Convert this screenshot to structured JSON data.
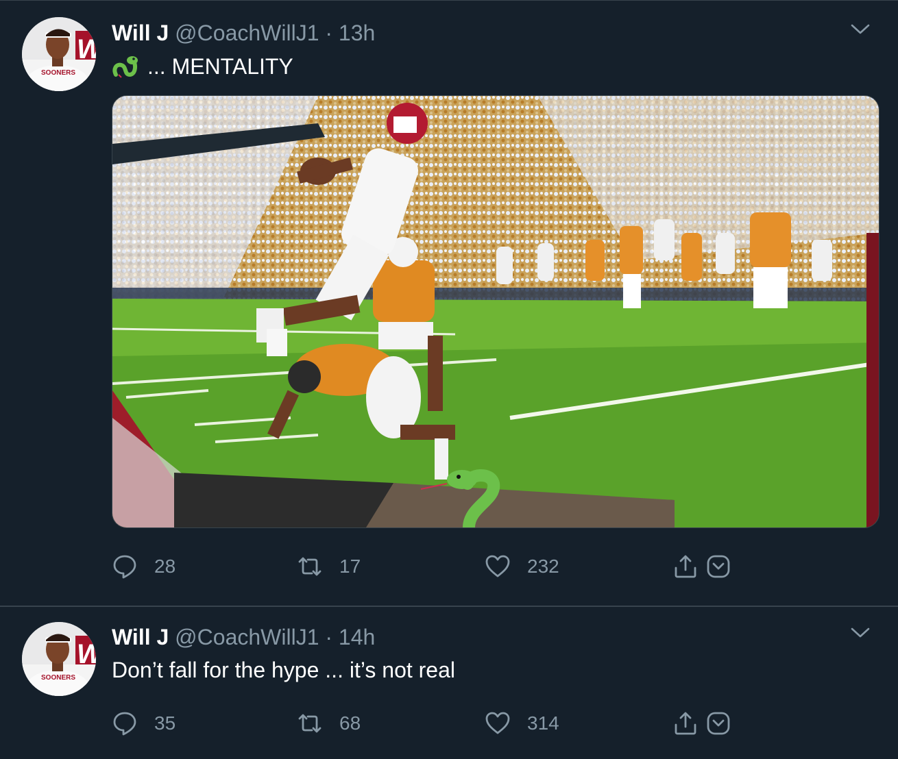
{
  "colors": {
    "background": "#15202b",
    "border": "#38444d",
    "primary_text": "#ffffff",
    "secondary_text": "#8899a6",
    "snake_green": "#6cc04a"
  },
  "tweets": [
    {
      "name": "Will J",
      "handle": "@CoachWillJ1",
      "separator": "·",
      "time": "13h",
      "emoji": "snake-icon",
      "text": "... MENTALITY",
      "has_media": true,
      "media_description_icon": "football-photo",
      "actions": {
        "replies": "28",
        "retweets": "17",
        "likes": "232"
      }
    },
    {
      "name": "Will J",
      "handle": "@CoachWillJ1",
      "separator": "·",
      "time": "14h",
      "text": "Don’t fall for the hype ... it’s not real",
      "has_media": false,
      "actions": {
        "replies": "35",
        "retweets": "68",
        "likes": "314"
      }
    }
  ],
  "avatar_text": {
    "letter": "W",
    "shirt": "SOONERS"
  }
}
